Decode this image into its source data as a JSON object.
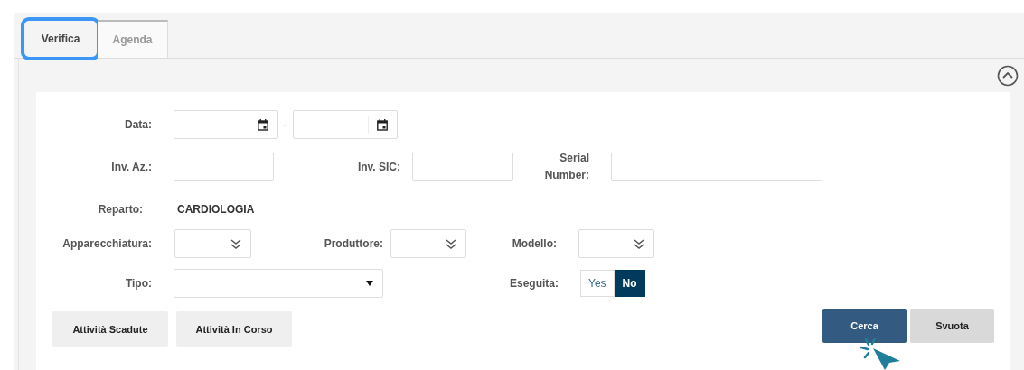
{
  "tabs": [
    {
      "label": "Verifica",
      "selected": true
    },
    {
      "label": "Agenda",
      "selected": false
    }
  ],
  "form": {
    "data": {
      "label": "Data:",
      "separator": "-"
    },
    "inv_az": {
      "label": "Inv. Az.:"
    },
    "inv_sic": {
      "label": "Inv. SIC:"
    },
    "serial_number": {
      "label": "Serial Number:"
    },
    "reparto": {
      "label": "Reparto:",
      "value": "CARDIOLOGIA"
    },
    "apparecchiatura": {
      "label": "Apparecchiatura:"
    },
    "produttore": {
      "label": "Produttore:"
    },
    "modello": {
      "label": "Modello:"
    },
    "tipo": {
      "label": "Tipo:"
    },
    "eseguita": {
      "label": "Eseguita:",
      "options": [
        {
          "label": "Yes",
          "selected": false
        },
        {
          "label": "No",
          "selected": true
        }
      ]
    }
  },
  "buttons": [
    {
      "label": "Attività Scadute",
      "kind": "secondary"
    },
    {
      "label": "Attività In Corso",
      "kind": "secondary"
    },
    {
      "label": "Cerca",
      "kind": "primary"
    },
    {
      "label": "Svuota",
      "kind": "clear"
    }
  ]
}
